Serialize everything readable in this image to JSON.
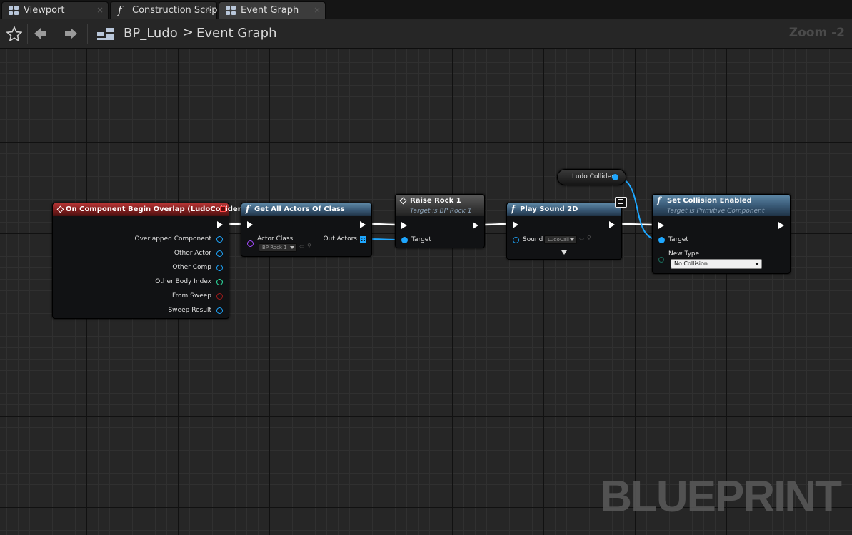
{
  "tabs": [
    {
      "label": "Viewport",
      "icon": "viewport-grid-icon"
    },
    {
      "label": "Construction Scrip",
      "icon": "function-icon"
    },
    {
      "label": "Event Graph",
      "icon": "event-graph-icon",
      "active": true
    }
  ],
  "breadcrumb": {
    "blueprint": "BP_Ludo",
    "separator": ">",
    "graph": "Event Graph"
  },
  "zoom_label": "Zoom -2",
  "watermark": "BLUEPRINT",
  "colors": {
    "exec": "#ffffff",
    "object_pin": "#1ea7ff",
    "class_pin": "#a24aff",
    "int_pin": "#2ee8a7",
    "bool_pin": "#a11a1a",
    "event_header": "#9c2b2b",
    "function_header": "#4a6f8e"
  },
  "nodes": {
    "overlap": {
      "title": "On Component Begin Overlap (LudoCollider)",
      "pins": {
        "overlapped_component": "Overlapped Component",
        "other_actor": "Other Actor",
        "other_comp": "Other Comp",
        "other_body_index": "Other Body Index",
        "from_sweep": "From Sweep",
        "sweep_result": "Sweep Result"
      }
    },
    "get_all_actors": {
      "title": "Get All Actors Of Class",
      "actor_class_label": "Actor Class",
      "actor_class_value": "BP Rock 1",
      "out_actors_label": "Out Actors"
    },
    "raise_rock": {
      "title": "Raise Rock 1",
      "subtitle": "Target is BP Rock 1",
      "target_label": "Target"
    },
    "play_sound": {
      "title": "Play Sound 2D",
      "sound_label": "Sound",
      "sound_value": "LudoCall"
    },
    "ludo_collider": {
      "label": "Ludo Collider"
    },
    "set_collision": {
      "title": "Set Collision Enabled",
      "subtitle": "Target is Primitive Component",
      "target_label": "Target",
      "new_type_label": "New Type",
      "new_type_value": "No Collision"
    }
  }
}
